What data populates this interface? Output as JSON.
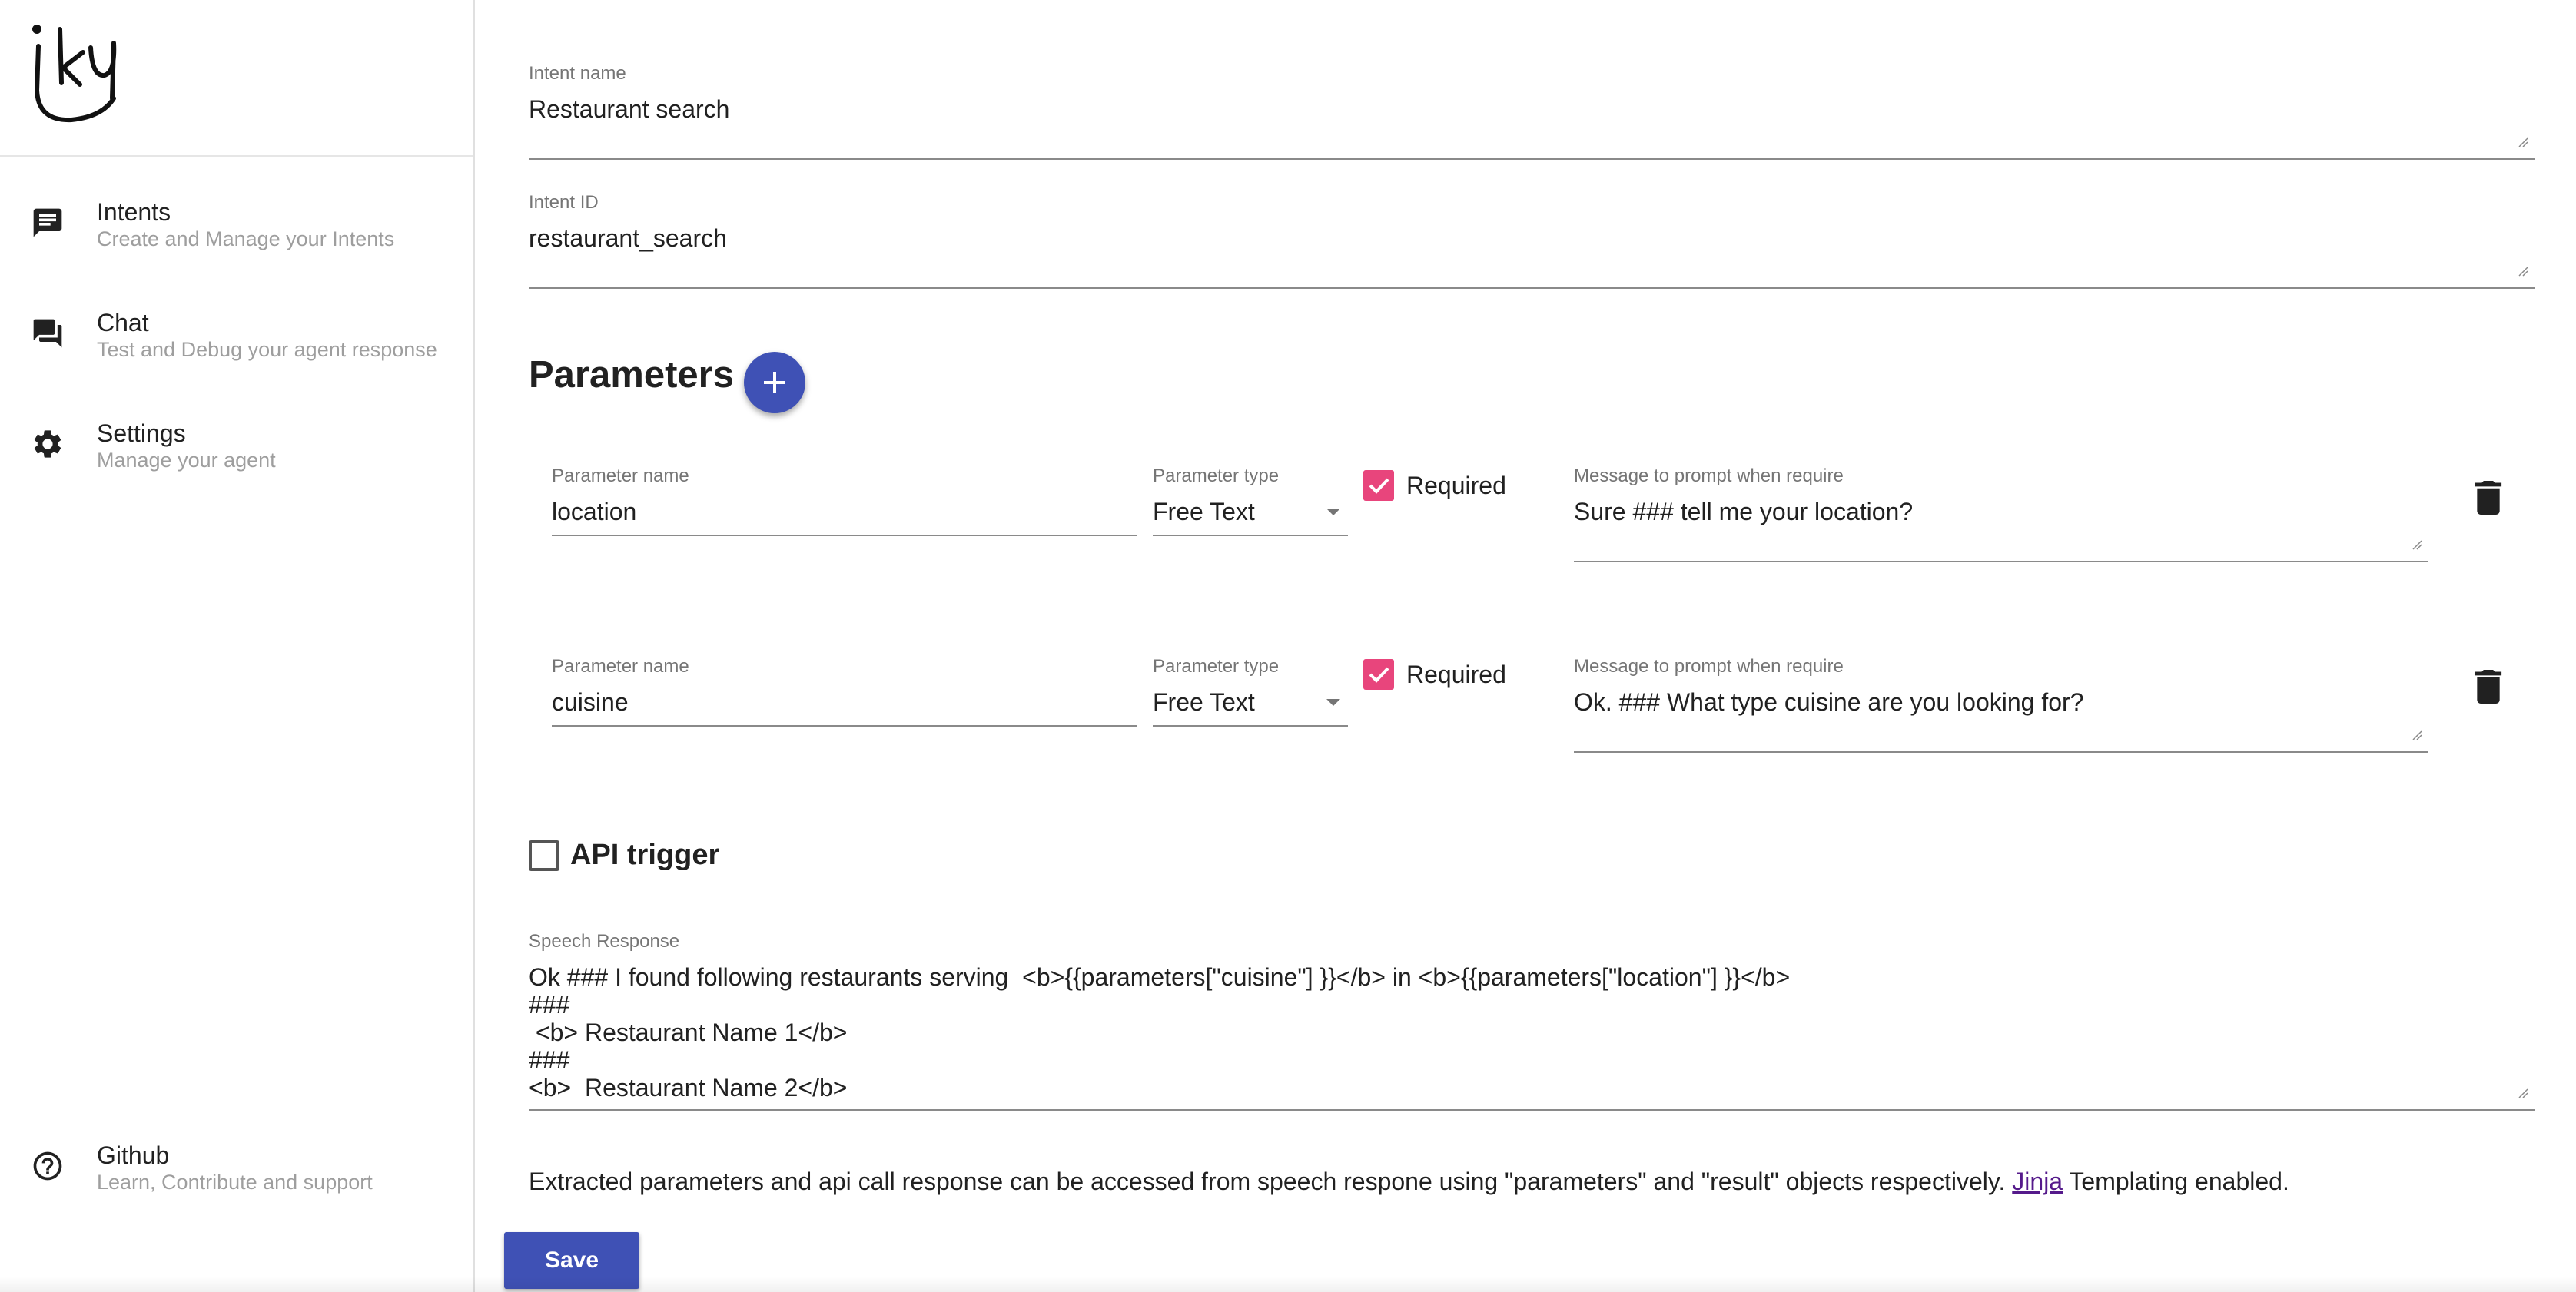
{
  "sidebar": {
    "logo_text": "iky",
    "items": [
      {
        "title": "Intents",
        "subtitle": "Create and Manage your Intents",
        "icon": "intents-message-icon"
      },
      {
        "title": "Chat",
        "subtitle": "Test and Debug your agent response",
        "icon": "chat-bubbles-icon"
      },
      {
        "title": "Settings",
        "subtitle": "Manage your agent",
        "icon": "gear-icon"
      },
      {
        "title": "Github",
        "subtitle": "Learn, Contribute and support",
        "icon": "help-circle-icon"
      }
    ]
  },
  "form": {
    "intent_name": {
      "label": "Intent name",
      "value": "Restaurant search"
    },
    "intent_id": {
      "label": "Intent ID",
      "value": "restaurant_search"
    },
    "parameters_title": "Parameters",
    "parameters": [
      {
        "name_label": "Parameter name",
        "name": "location",
        "type_label": "Parameter type",
        "type": "Free Text",
        "required_label": "Required",
        "required": true,
        "prompt_label": "Message to prompt when require",
        "prompt": "Sure ### tell me your location?"
      },
      {
        "name_label": "Parameter name",
        "name": "cuisine",
        "type_label": "Parameter type",
        "type": "Free Text",
        "required_label": "Required",
        "required": true,
        "prompt_label": "Message to prompt when require",
        "prompt": "Ok. ### What type cuisine are you looking for?"
      }
    ],
    "api_trigger": {
      "label": "API trigger",
      "checked": false
    },
    "speech_response": {
      "label": "Speech Response",
      "lines": [
        "Ok ### I found following restaurants serving  <b>{{parameters[\"cuisine\"] }}</b> in <b>{{parameters[\"location\"] }}</b>",
        "###",
        " <b> Restaurant Name 1</b>",
        "###",
        "<b>  Restaurant Name 2</b>"
      ]
    },
    "info": {
      "before": "Extracted parameters and api call response can be accessed from speech respone using \"parameters\" and \"result\" objects respectively. ",
      "link": "Jinja",
      "after": " Templating enabled."
    },
    "save_label": "Save"
  },
  "colors": {
    "primary": "#3f51b5",
    "checkbox": "#e8457c",
    "link": "#551a8b"
  }
}
